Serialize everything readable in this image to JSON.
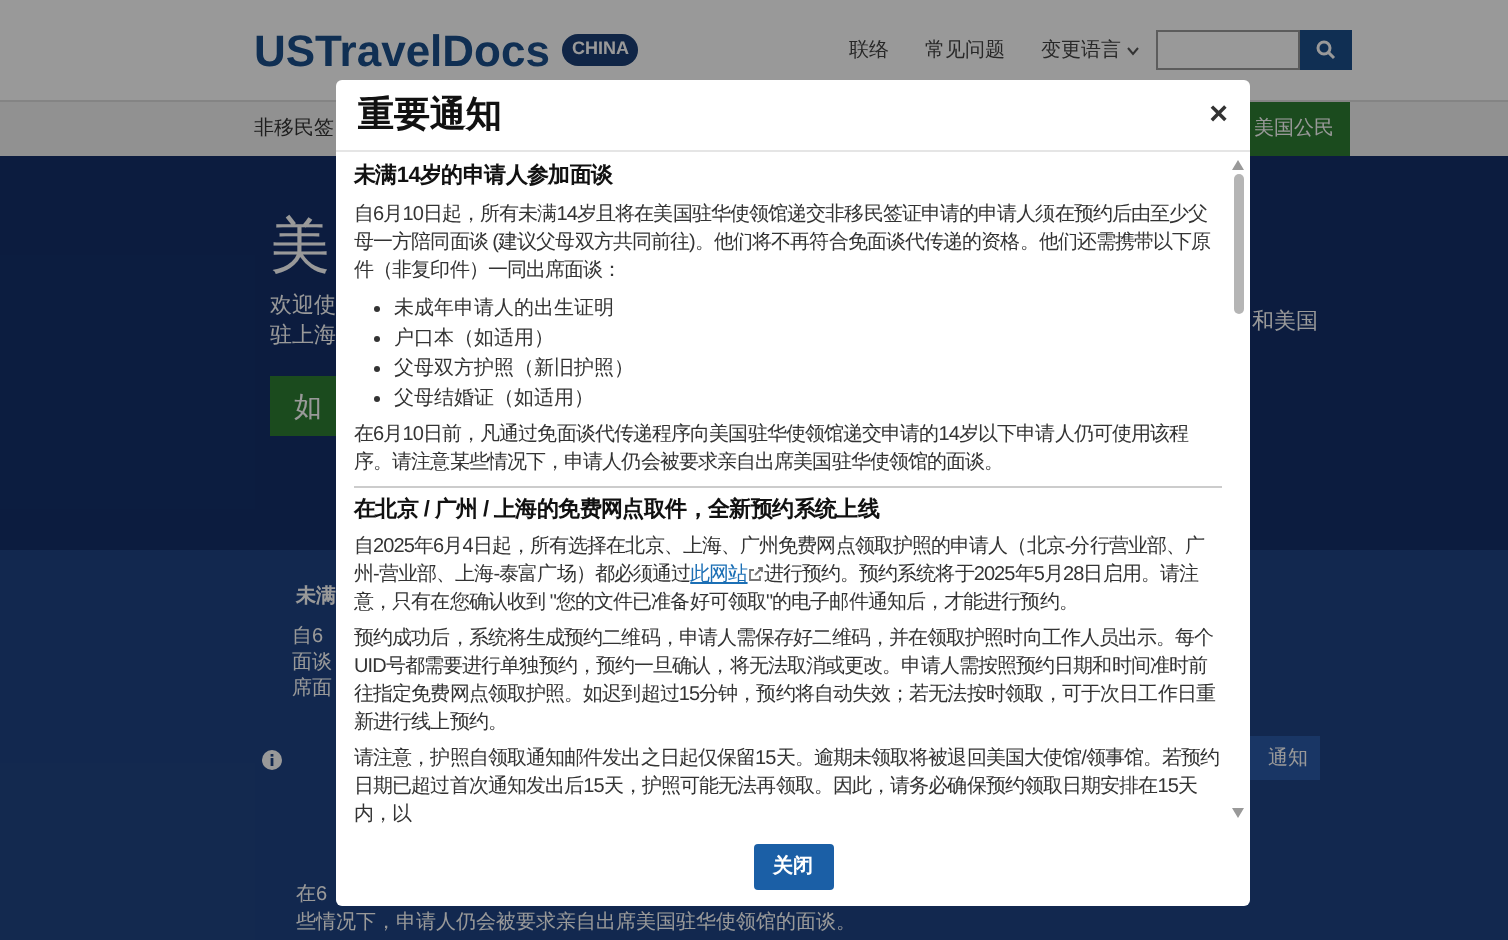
{
  "header": {
    "logo": "USTravelDocs",
    "badge": "CHINA",
    "nav": [
      "联络",
      "常见问题",
      "变更语言"
    ]
  },
  "nav_bar": {
    "left_item": "非移民签",
    "highlight_button": "美国公民"
  },
  "hero": {
    "title": "美",
    "intro_left": [
      "欢迎使",
      "驻上海"
    ],
    "intro_right": "和美国",
    "button": "如"
  },
  "notice_section": {
    "heading": "未满",
    "lines": [
      "自6",
      "面谈",
      "席面"
    ],
    "button": "通知",
    "footer_lines": [
      "在6",
      "些情况下，申请人仍会被要求亲自出席美国驻华使领馆的面谈。"
    ]
  },
  "modal": {
    "title": "重要通知",
    "close": "×",
    "sections": [
      {
        "heading": "未满14岁的申请人参加面谈",
        "blocks": [
          {
            "kind": "paragraph",
            "text": "自6月10日起，所有未满14岁且将在美国驻华使领馆递交非移民签证申请的申请人须在预约后由至少父母一方陪同面谈 (建议父母双方共同前往)。他们将不再符合免面谈代传递的资格。他们还需携带以下原件（非复印件）一同出席面谈："
          },
          {
            "kind": "list",
            "items": [
              "未成年申请人的出生证明",
              "户口本（如适用）",
              "父母双方护照（新旧护照）",
              "父母结婚证（如适用）"
            ]
          },
          {
            "kind": "paragraph",
            "text": "在6月10日前，凡通过免面谈代传递程序向美国驻华使领馆递交申请的14岁以下申请人仍可使用该程序。请注意某些情况下，申请人仍会被要求亲自出席美国驻华使领馆的面谈。"
          }
        ]
      },
      {
        "heading": "在北京 / 广州 / 上海的免费网点取件，全新预约系统上线",
        "blocks": [
          {
            "kind": "linked_paragraph",
            "before": "自2025年6月4日起，所有选择在北京、上海、广州免费网点领取护照的申请人（北京-分行营业部、广州-营业部、上海-泰富广场）都必须通过",
            "link": "此网站",
            "after": "进行预约。预约系统将于2025年5月28日启用。请注意，只有在您确认收到 \"您的文件已准备好可领取\"的电子邮件通知后，才能进行预约。"
          },
          {
            "kind": "paragraph",
            "text": "预约成功后，系统将生成预约二维码，申请人需保存好二维码，并在领取护照时向工作人员出示。每个UID号都需要进行单独预约，预约一旦确认，将无法取消或更改。申请人需按照预约日期和时间准时前往指定免费网点领取护照。如迟到超过15分钟，预约将自动失效；若无法按时领取，可于次日工作日重新进行线上预约。"
          },
          {
            "kind": "paragraph",
            "text": "请注意，护照自领取通知邮件发出之日起仅保留15天。逾期未领取将被退回美国大使馆/领事馆。若预约日期已超过首次通知发出后15天，护照可能无法再领取。因此，请务必确保预约领取日期安排在15天内，以"
          }
        ]
      }
    ],
    "button": "关闭"
  }
}
